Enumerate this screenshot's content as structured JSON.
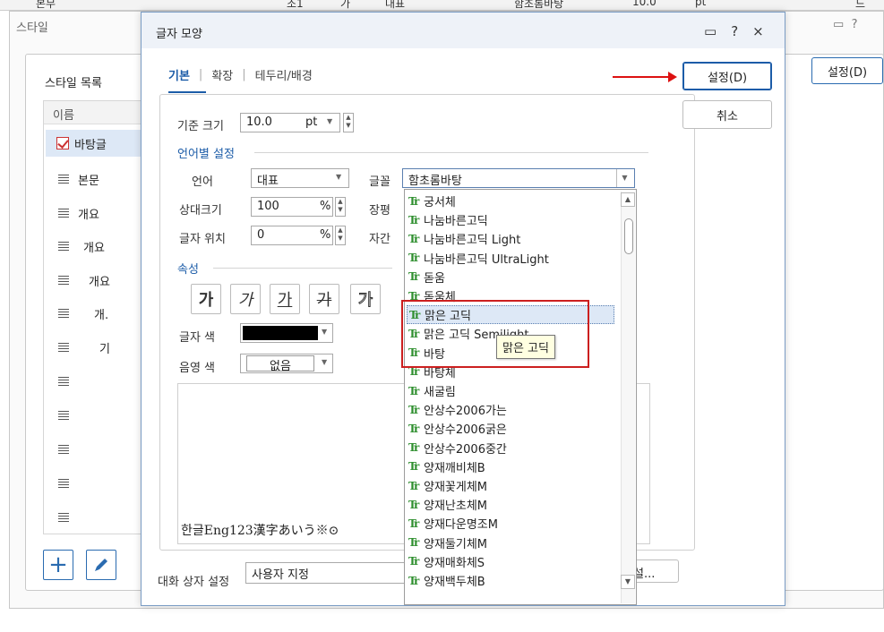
{
  "top_strip": {
    "items": [
      "본무",
      "조1",
      "가",
      "대표",
      "함초롬바탕",
      "10.0",
      "pt",
      "드"
    ]
  },
  "style_dialog": {
    "title": "스타일",
    "ctrl_icons": [
      "window-icon",
      "help-icon"
    ],
    "help_label": "?",
    "list_label": "스타일 목록",
    "list_header": "이름",
    "items": [
      "바탕글",
      "본문",
      "개요",
      "개요",
      "개요",
      "개.",
      "기",
      "",
      "",
      "",
      "",
      ""
    ],
    "setting_label": "설정(D)"
  },
  "char_dialog": {
    "title": "글자 모양",
    "help_label": "?",
    "close_label": "×",
    "tabs": [
      "기본",
      "확장",
      "테두리/배경"
    ],
    "base_size": {
      "label": "기준 크기",
      "value": "10.0",
      "unit": "pt"
    },
    "lang_section": "언어별 설정",
    "language": {
      "label": "언어",
      "value": "대표"
    },
    "font": {
      "label": "글꼴",
      "value": "함초롬바탕"
    },
    "rel_size": {
      "label": "상대크기",
      "value": "100",
      "unit": "%"
    },
    "position": {
      "label": "글자 위치",
      "value": "0",
      "unit": "%"
    },
    "width_label": "장평",
    "spacing_label": "자간",
    "attr_section": "속성",
    "attr_buttons": [
      "가",
      "가",
      "가",
      "가",
      "가"
    ],
    "text_color_label": "글자 색",
    "text_color": "#000000",
    "shade_color_label": "음영 색",
    "shade_color_value": "없음",
    "preview_text": "한글Eng123漢字あいう※⊙",
    "setting_label": "설정(D)",
    "cancel_label": "취소",
    "dialog_setting_label": "대화 상자 설정",
    "dialog_setting_value": "사용자 지정",
    "more_button_label": "설..."
  },
  "font_list": {
    "items": [
      "궁서체",
      "나눔바른고딕",
      "나눔바른고딕 Light",
      "나눔바른고딕 UltraLight",
      "돋움",
      "돋움체",
      "맑은 고딕",
      "맑은 고딕 Semilight",
      "바탕",
      "바탕체",
      "새굴림",
      "안상수2006가는",
      "안상수2006굵은",
      "안상수2006중간",
      "양재깨비체B",
      "양재꽃게체M",
      "양재난초체M",
      "양재다운명조M",
      "양재둘기체M",
      "양재매화체S",
      "양재백두체B"
    ],
    "highlighted_index": 6,
    "tooltip": "맑은 고딕"
  },
  "colors": {
    "accent": "#1c5ca8",
    "annotation": "#cc1f1f",
    "truetype_icon": "#2f8f2f"
  }
}
